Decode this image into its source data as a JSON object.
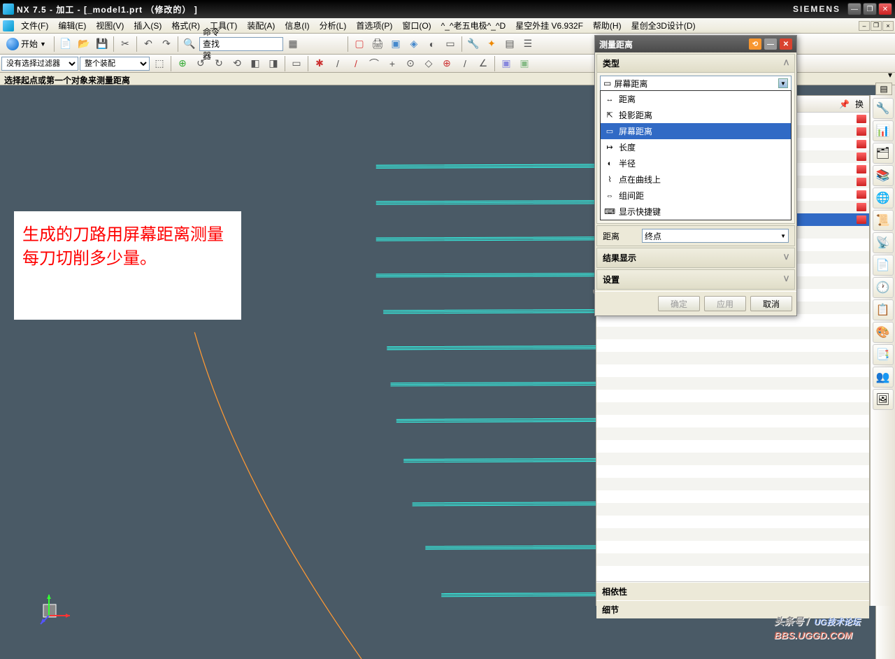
{
  "title": "NX 7.5 - 加工 - [_model1.prt （修改的） ]",
  "brand": "SIEMENS",
  "menu": {
    "file": "文件(F)",
    "edit": "编辑(E)",
    "view": "视图(V)",
    "insert": "插入(S)",
    "format": "格式(R)",
    "tools": "工具(T)",
    "assembly": "装配(A)",
    "info": "信息(I)",
    "analyze": "分析(L)",
    "pref": "首选项(P)",
    "window": "窗口(O)",
    "plugin1": "^_^老五电极^_^D",
    "plugin2": "星空外挂 V6.932F",
    "help": "帮助(H)",
    "plugin3": "星创全3D设计(D)"
  },
  "toolbar1": {
    "start": "开始",
    "cmdfinder_label": "命令查找器",
    "cmdfinder_ph": ""
  },
  "toolbar2": {
    "filter_sel": "没有选择过滤器",
    "assembly_sel": "整个装配"
  },
  "status": "选择起点或第一个对象来测量距离",
  "note": "生成的刀路用屏幕距离测量每刀切削多少量。",
  "dialog": {
    "title": "测量距离",
    "section_type": "类型",
    "type_selected": "屏幕距离",
    "options": [
      {
        "icon": "↔",
        "label": "距离"
      },
      {
        "icon": "⇱",
        "label": "投影距离"
      },
      {
        "icon": "▭",
        "label": "屏幕距离"
      },
      {
        "icon": "↦",
        "label": "长度"
      },
      {
        "icon": "◐",
        "label": "半径"
      },
      {
        "icon": "⌇",
        "label": "点在曲线上"
      },
      {
        "icon": "⇔",
        "label": "组间距"
      },
      {
        "icon": "⌨",
        "label": "显示快捷键"
      }
    ],
    "dist_label": "距离",
    "dist_value": "终点",
    "results": "结果显示",
    "settings": "设置",
    "ok": "确定",
    "apply": "应用",
    "cancel": "取消"
  },
  "rpanel": {
    "dep": "相依性",
    "detail": "细节",
    "switch": "换"
  },
  "watermark": {
    "main": "UG技术论坛",
    "sub": "头条号 /",
    "bbs": "BBS.UGGD.COM"
  }
}
